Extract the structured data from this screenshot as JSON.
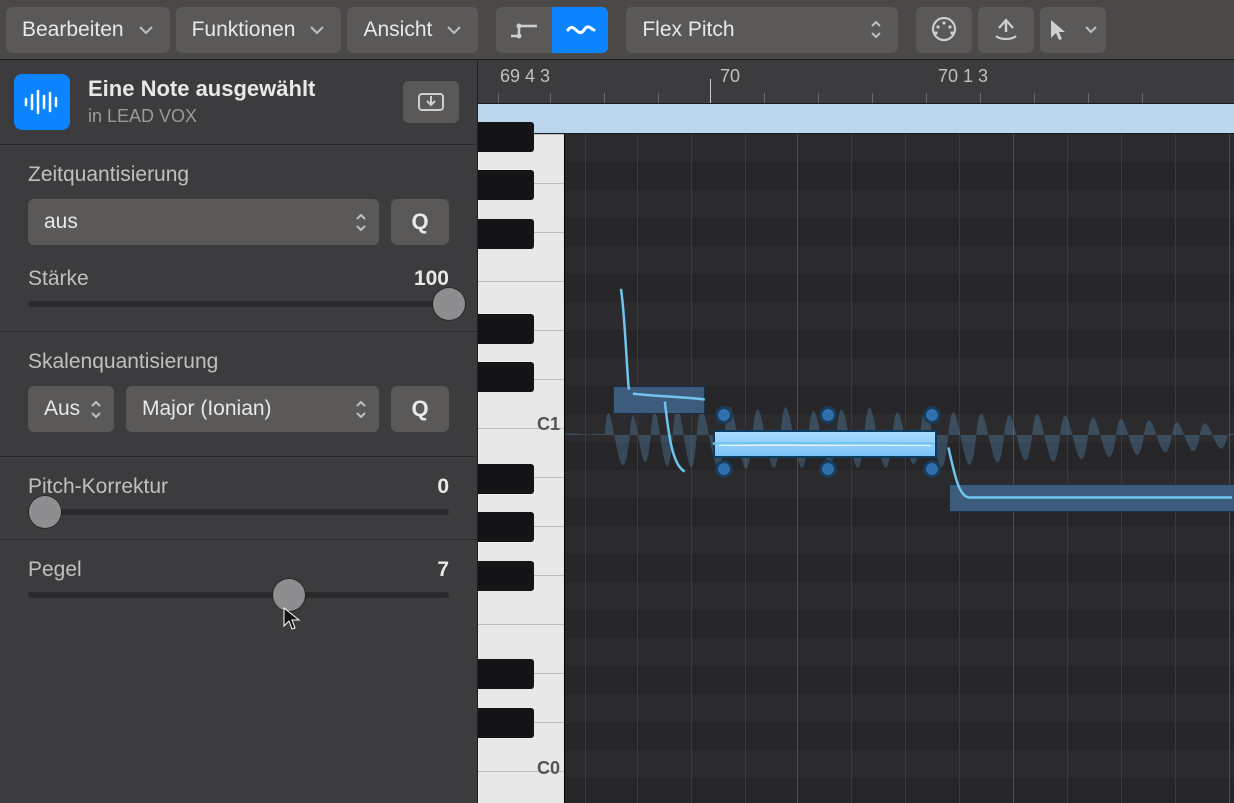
{
  "toolbar": {
    "edit": "Bearbeiten",
    "functions": "Funktionen",
    "view": "Ansicht",
    "flex_mode": "Flex Pitch"
  },
  "header": {
    "title": "Eine Note ausgewählt",
    "subtitle": "in LEAD VOX"
  },
  "timequant": {
    "label": "Zeitquantisierung",
    "value": "aus",
    "q": "Q"
  },
  "strength": {
    "label": "Stärke",
    "value": "100"
  },
  "scalequant": {
    "label": "Skalenquantisierung",
    "onoff": "Aus",
    "scale": "Major (Ionian)",
    "q": "Q"
  },
  "pitchcorr": {
    "label": "Pitch-Korrektur",
    "value": "0"
  },
  "gain": {
    "label": "Pegel",
    "value": "7"
  },
  "ruler": {
    "m0": "69 4 3",
    "m1": "70",
    "m2": "70 1 3"
  },
  "piano": {
    "c1": "C1",
    "c0": "C0"
  }
}
